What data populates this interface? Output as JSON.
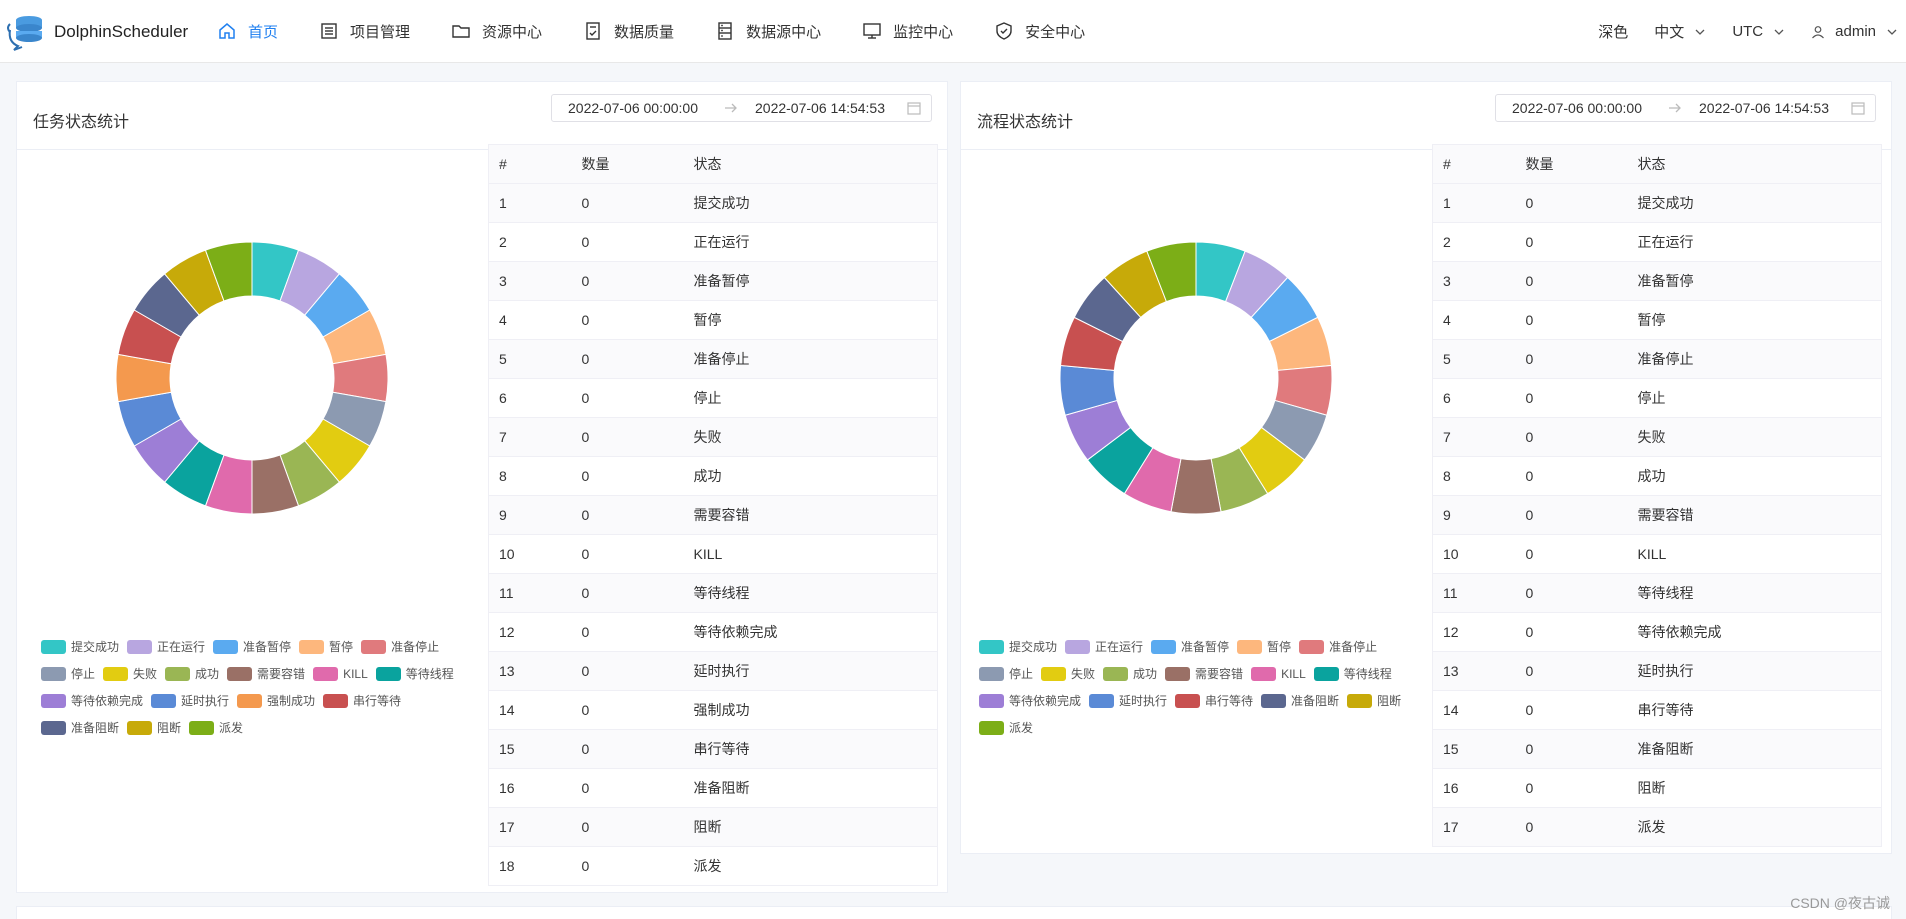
{
  "app": {
    "name": "DolphinScheduler"
  },
  "nav": [
    {
      "label": "首页",
      "icon": "home-icon",
      "active": true
    },
    {
      "label": "项目管理",
      "icon": "project-list-icon",
      "active": false
    },
    {
      "label": "资源中心",
      "icon": "folder-icon",
      "active": false
    },
    {
      "label": "数据质量",
      "icon": "document-check-icon",
      "active": false
    },
    {
      "label": "数据源中心",
      "icon": "database-icon",
      "active": false
    },
    {
      "label": "监控中心",
      "icon": "monitor-icon",
      "active": false
    },
    {
      "label": "安全中心",
      "icon": "shield-icon",
      "active": false
    }
  ],
  "tools": {
    "theme": "深色",
    "language": "中文",
    "timezone": "UTC",
    "user": "admin"
  },
  "colors": {
    "accent": "#2080f0",
    "palette": [
      "#33c6c6",
      "#b8a6e0",
      "#5aaaf0",
      "#fdb77d",
      "#e07a7d",
      "#8c9ab1",
      "#e2cc11",
      "#9ab654",
      "#9a7066",
      "#e06aac",
      "#0aa39e",
      "#9d7ed6",
      "#5a8ad6",
      "#f4994e",
      "#c85050",
      "#5b678f",
      "#c7aa09",
      "#7cae17"
    ]
  },
  "task_panel": {
    "title": "任务状态统计",
    "date_start": "2022-07-06 00:00:00",
    "date_end": "2022-07-06 14:54:53",
    "columns": [
      "#",
      "数量",
      "状态"
    ],
    "rows": [
      [
        "1",
        "0",
        "提交成功"
      ],
      [
        "2",
        "0",
        "正在运行"
      ],
      [
        "3",
        "0",
        "准备暂停"
      ],
      [
        "4",
        "0",
        "暂停"
      ],
      [
        "5",
        "0",
        "准备停止"
      ],
      [
        "6",
        "0",
        "停止"
      ],
      [
        "7",
        "0",
        "失败"
      ],
      [
        "8",
        "0",
        "成功"
      ],
      [
        "9",
        "0",
        "需要容错"
      ],
      [
        "10",
        "0",
        "KILL"
      ],
      [
        "11",
        "0",
        "等待线程"
      ],
      [
        "12",
        "0",
        "等待依赖完成"
      ],
      [
        "13",
        "0",
        "延时执行"
      ],
      [
        "14",
        "0",
        "强制成功"
      ],
      [
        "15",
        "0",
        "串行等待"
      ],
      [
        "16",
        "0",
        "准备阻断"
      ],
      [
        "17",
        "0",
        "阻断"
      ],
      [
        "18",
        "0",
        "派发"
      ]
    ],
    "legend": [
      "提交成功",
      "正在运行",
      "准备暂停",
      "暂停",
      "准备停止",
      "停止",
      "失败",
      "成功",
      "需要容错",
      "KILL",
      "等待线程",
      "等待依赖完成",
      "延时执行",
      "强制成功",
      "串行等待",
      "准备阻断",
      "阻断",
      "派发"
    ]
  },
  "process_panel": {
    "title": "流程状态统计",
    "date_start": "2022-07-06 00:00:00",
    "date_end": "2022-07-06 14:54:53",
    "columns": [
      "#",
      "数量",
      "状态"
    ],
    "rows": [
      [
        "1",
        "0",
        "提交成功"
      ],
      [
        "2",
        "0",
        "正在运行"
      ],
      [
        "3",
        "0",
        "准备暂停"
      ],
      [
        "4",
        "0",
        "暂停"
      ],
      [
        "5",
        "0",
        "准备停止"
      ],
      [
        "6",
        "0",
        "停止"
      ],
      [
        "7",
        "0",
        "失败"
      ],
      [
        "8",
        "0",
        "成功"
      ],
      [
        "9",
        "0",
        "需要容错"
      ],
      [
        "10",
        "0",
        "KILL"
      ],
      [
        "11",
        "0",
        "等待线程"
      ],
      [
        "12",
        "0",
        "等待依赖完成"
      ],
      [
        "13",
        "0",
        "延时执行"
      ],
      [
        "14",
        "0",
        "串行等待"
      ],
      [
        "15",
        "0",
        "准备阻断"
      ],
      [
        "16",
        "0",
        "阻断"
      ],
      [
        "17",
        "0",
        "派发"
      ]
    ],
    "legend": [
      "提交成功",
      "正在运行",
      "准备暂停",
      "暂停",
      "准备停止",
      "停止",
      "失败",
      "成功",
      "需要容错",
      "KILL",
      "等待线程",
      "等待依赖完成",
      "延时执行",
      "串行等待",
      "准备阻断",
      "阻断",
      "派发"
    ]
  },
  "watermark": "CSDN @夜古诚"
}
